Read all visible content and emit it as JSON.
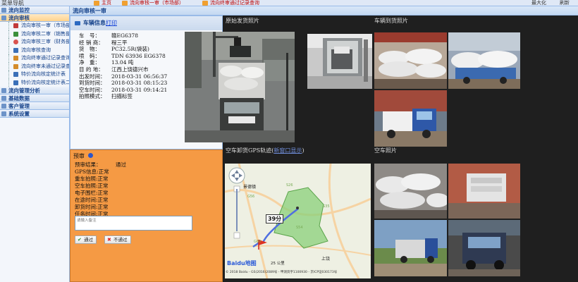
{
  "topbar": {
    "nav_title": "菜单导航",
    "tabs": [
      {
        "label": "主页"
      },
      {
        "label": "流向审核一审（市场部）"
      },
      {
        "label": "流向终审通过记录查询"
      }
    ],
    "right_items": [
      "最大化",
      "刷新"
    ]
  },
  "sidebar": {
    "groups_top": [
      {
        "label": "流向监控"
      },
      {
        "label": "流向审核"
      }
    ],
    "items": [
      {
        "label": "流向审核一审（市场部）",
        "color": "#c23b3b"
      },
      {
        "label": "流向审核二审（销售部）",
        "color": "#3b8f3b"
      },
      {
        "label": "流向审核三审（财务部）",
        "color": "#d9534f"
      },
      {
        "label": "流向审核查询",
        "color": "#3b6fb8"
      },
      {
        "label": "流向终审通过记录查询",
        "color": "#d48b2a"
      },
      {
        "label": "流向终审未通过记录查询",
        "color": "#d48b2a"
      },
      {
        "label": "特价流向核定统计表",
        "color": "#3b6fb8"
      },
      {
        "label": "特价流向核定统计表二",
        "color": "#3b6fb8"
      }
    ],
    "groups_bottom": [
      {
        "label": "流向管理分析"
      },
      {
        "label": "基础数据"
      },
      {
        "label": "客户管理"
      },
      {
        "label": "系统设置"
      }
    ]
  },
  "main": {
    "title": "流向审核一审"
  },
  "info": {
    "header_label": "车辆信息",
    "print_link": "打印",
    "rows": [
      {
        "label": "车　号：",
        "value": "赣EG6378"
      },
      {
        "label": "经 销 商：",
        "value": "程三平"
      },
      {
        "label": "货　物：",
        "value": "PC32.5R(袋装)"
      },
      {
        "label": "喷　码：",
        "value": "TDN 63936 EG6378"
      },
      {
        "label": "净　重：",
        "value": "13.04 吨"
      },
      {
        "label": "目 的 地：",
        "value": "江西上饶德兴市"
      },
      {
        "label": "出发时间：",
        "value": "2018-03-31 06:56:37"
      },
      {
        "label": "到货时间：",
        "value": "2018-03-31 08:15:23"
      },
      {
        "label": "空车时间：",
        "value": "2018-03-31 09:14:21"
      },
      {
        "label": "拍照模式：",
        "value": "扫描标签"
      }
    ]
  },
  "review": {
    "header": "预审",
    "result_label": "预审结果：",
    "result_value": "通过",
    "checks": [
      "GPS信息:正常",
      "重车拍照:正常",
      "空车拍照:正常",
      "电子围栏:正常",
      "在途时间:正常",
      "卸货时间:正常",
      "任务时间:正常"
    ],
    "remark_placeholder": "请输入备注",
    "pass_label": "通过",
    "reject_label": "不通过"
  },
  "gallery": {
    "origin_label": "原始发货照片",
    "arrival_label": "车辆到货照片",
    "gps_label": "空车卸货GPS轨迹(",
    "gps_link": "新窗口显示",
    "gps_label_end": ")",
    "empty_label": "空车照片"
  },
  "map": {
    "time_badge": "39分",
    "city": "景德镇",
    "city2": "上饶",
    "scale": "25 公里",
    "logo": "Baidu地图",
    "copyright": "© 2018 Baidu - GS(2016)2089号 - 甲测资字1100930 - 京ICP证030173号",
    "road_numbers": [
      "G56",
      "S26",
      "S35",
      "S54",
      "G60"
    ]
  }
}
